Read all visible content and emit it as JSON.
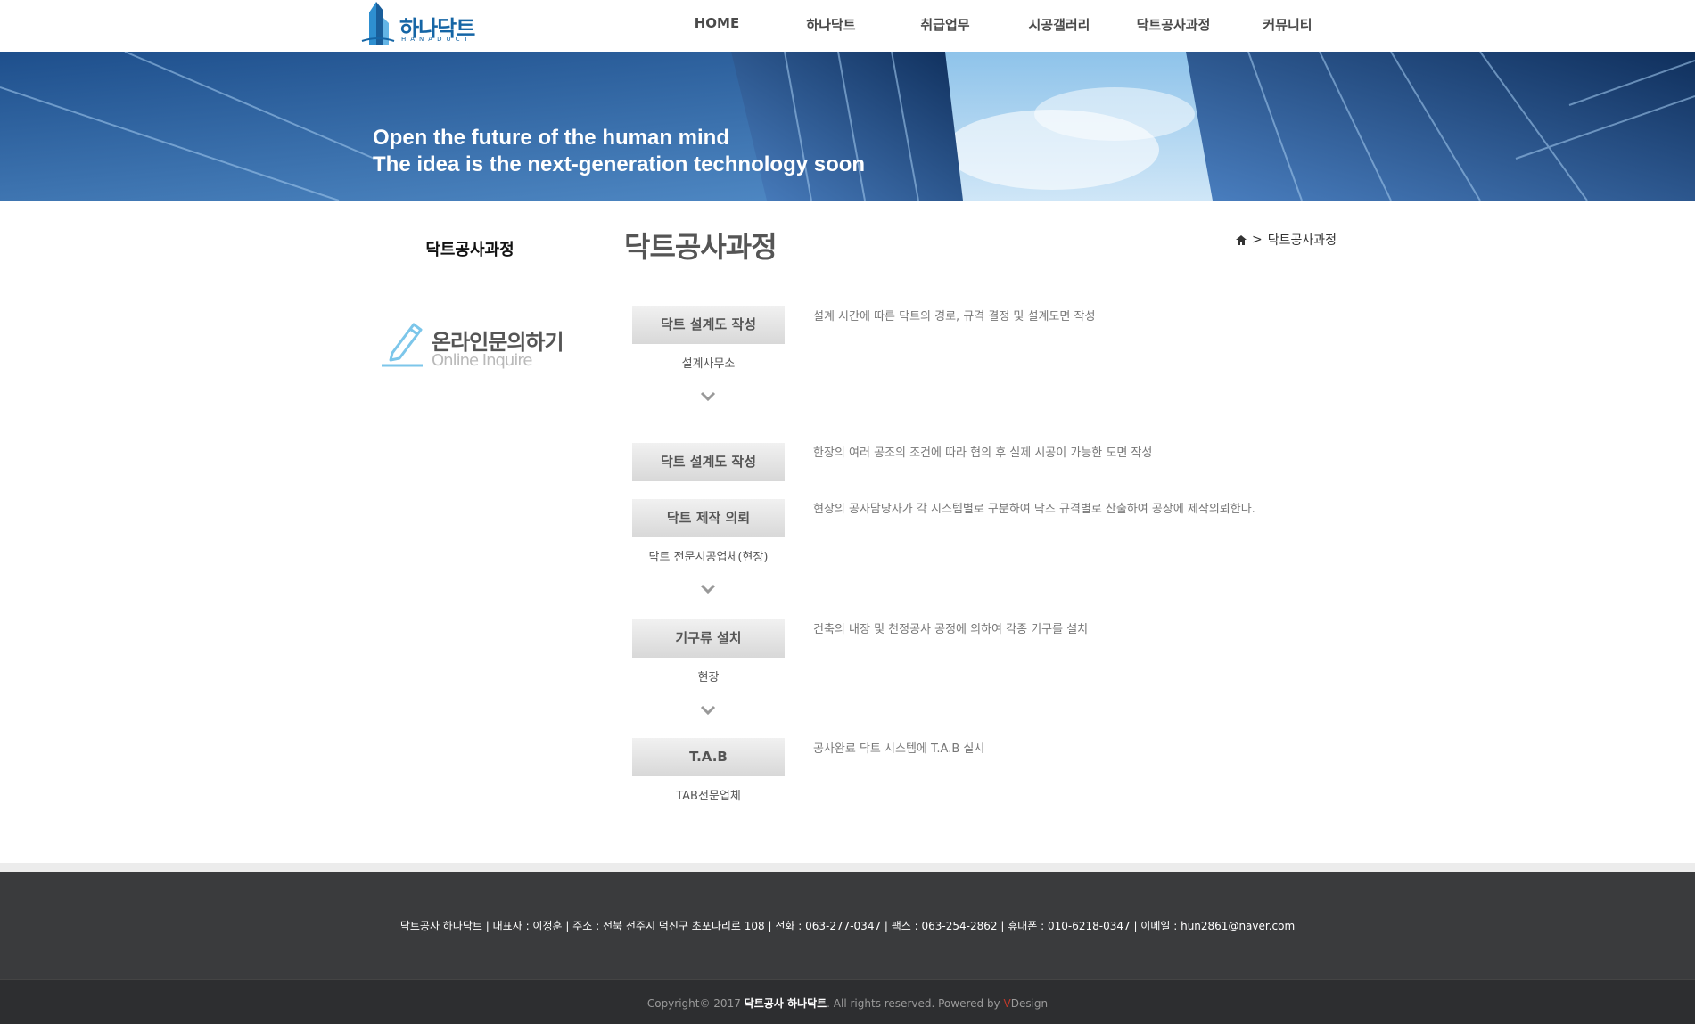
{
  "header": {
    "logo_text": "하나닥트",
    "logo_sub": "HANADUCT",
    "nav": [
      "HOME",
      "하나닥트",
      "취급업무",
      "시공갤러리",
      "닥트공사과정",
      "커뮤니티"
    ]
  },
  "banner": {
    "line1": "Open the future of the human mind",
    "line2": "The idea is the next-generation technology soon"
  },
  "sidebar": {
    "title": "닥트공사과정",
    "inquire_ko": "온라인문의하기",
    "inquire_en": "Online Inquire"
  },
  "main": {
    "title": "닥트공사과정",
    "breadcrumb": "닥트공사과정",
    "breadcrumb_sep": ">",
    "steps": [
      {
        "label": "닥트 설계도 작성",
        "sub": "설계사무소",
        "desc": "설계 시간에 따른 닥트의 경로, 규격 결정 및 설계도면 작성"
      },
      {
        "label": "닥트 설계도 작성",
        "sub": "",
        "desc": "한장의 여러 공조의 조건에 따라 협의 후 실제 시공이 가능한 도면 작성"
      },
      {
        "label": "닥트 제작 의뢰",
        "sub": "닥트 전문시공업체(현장)",
        "desc": "현장의 공사담당자가 각 시스템별로 구분하여 닥즈 규격별로 산출하여 공장에 제작의뢰한다."
      },
      {
        "label": "기구류 설치",
        "sub": "현장",
        "desc": "건축의 내장 및 천정공사 공정에 의하여 각종 기구를 설치"
      },
      {
        "label": "T.A.B",
        "sub": "TAB전문업체",
        "desc": "공사완료 닥트 시스템에 T.A.B 실시"
      }
    ]
  },
  "footer": {
    "info": "닥트공사 하나닥트 | 대표자 : 이정훈 | 주소 : 전북 전주시 덕진구 초포다리로 108 | 전화 : 063-277-0347 | 팩스 : 063-254-2862 | 휴대폰 : 010-6218-0347 | 이메일 : hun2861@naver.com",
    "copyright_prefix": "Copyright© 2017",
    "copyright_company": "닥트공사 하나닥트",
    "copyright_suffix": ". All rights reserved. Powered by",
    "powered_v": "V",
    "powered_rest": "Design"
  }
}
